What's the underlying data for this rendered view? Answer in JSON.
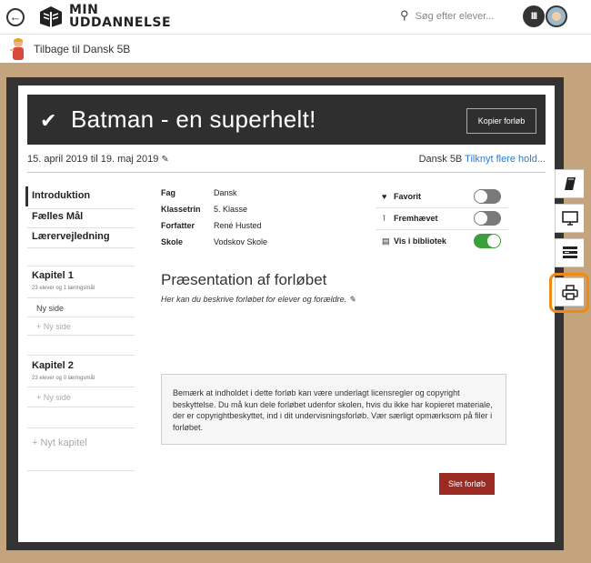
{
  "header": {
    "logo_line1": "MIN",
    "logo_line2": "UDDANNELSE",
    "search_placeholder": "Søg efter elever...",
    "library_icon_label": "III"
  },
  "subheader": {
    "back_label": "Tilbage til Dansk 5B"
  },
  "course": {
    "title": "Batman - en superhelt!",
    "copy_button": "Kopier forløb",
    "dates": "15. april 2019 til 19. maj 2019",
    "team_prefix": "Dansk 5B",
    "team_link": "Tilknyt flere hold..."
  },
  "nav": {
    "items": [
      "Introduktion",
      "Fælles Mål",
      "Lærervejledning"
    ],
    "chapters": [
      {
        "title": "Kapitel 1",
        "meta": "23 elever og 1 læringsmål",
        "pages": [
          "Ny side"
        ],
        "new_page": "+ Ny side"
      },
      {
        "title": "Kapitel 2",
        "meta": "23 elever og 0 læringsmål",
        "pages": [],
        "new_page": "+ Ny side"
      }
    ],
    "new_chapter": "+ Nyt kapitel"
  },
  "meta": [
    {
      "key": "Fag",
      "value": "Dansk"
    },
    {
      "key": "Klassetrin",
      "value": "5. Klasse"
    },
    {
      "key": "Forfatter",
      "value": "René Husted"
    },
    {
      "key": "Skole",
      "value": "Vodskov Skole"
    }
  ],
  "toggles": [
    {
      "label": "Favorit",
      "icon": "heart-icon",
      "on": false
    },
    {
      "label": "Fremhævet",
      "icon": "pin-icon",
      "on": false
    },
    {
      "label": "Vis i bibliotek",
      "icon": "book-icon",
      "on": true
    }
  ],
  "presentation": {
    "heading": "Præsentation af forløbet",
    "description": "Her kan du beskrive forløbet for elever og forældre."
  },
  "notice": "Bemærk at indholdet i dette forløb kan være underlagt licensregler og copyright beskyttelse. Du må kun dele forløbet udenfor skolen, hvis du ikke har kopieret materiale, der er copyrightbeskyttet, ind i dit undervisningsforløb. Vær særligt opmærksom på filer i forløbet.",
  "delete_button": "Slet forløb",
  "side_tabs": [
    "book-icon",
    "monitor-icon",
    "list-icon",
    "print-icon"
  ],
  "colors": {
    "hero_bg": "#2f2f2f",
    "delete_bg": "#9a2a22",
    "toggle_on": "#3aa03a",
    "link": "#2b7bd6",
    "highlight": "#f08a16",
    "backdrop": "#c4a47c"
  }
}
